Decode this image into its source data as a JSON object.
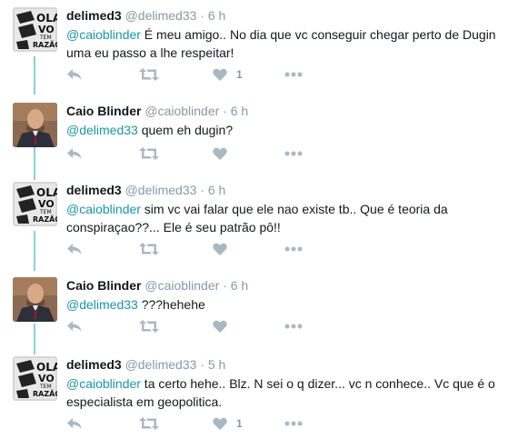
{
  "tweets": [
    {
      "author": "delimed3",
      "handle": "@delimed33",
      "time": "6 h",
      "mention": "@caioblinder",
      "text": " É meu amigo.. No dia que vc conseguir chegar perto de Dugin uma eu passo a lhe respeitar!",
      "like_count": "1",
      "avatar": "delimed-avatar"
    },
    {
      "author": "Caio Blinder",
      "handle": "@caioblinder",
      "time": "6 h",
      "mention": "@delimed33",
      "text": " quem eh dugin?",
      "like_count": "",
      "avatar": "caio-avatar"
    },
    {
      "author": "delimed3",
      "handle": "@delimed33",
      "time": "6 h",
      "mention": "@caioblinder",
      "text": " sim vc vai falar que ele nao existe tb.. Que é teoria da conspiraçao??... Ele é seu patrão pô!!",
      "like_count": "",
      "avatar": "delimed-avatar"
    },
    {
      "author": "Caio Blinder",
      "handle": "@caioblinder",
      "time": "6 h",
      "mention": "@delimed33",
      "text": " ???hehehe",
      "like_count": "",
      "avatar": "caio-avatar"
    },
    {
      "author": "delimed3",
      "handle": "@delimed33",
      "time": "5 h",
      "mention": "@caioblinder",
      "text": " ta certo hehe.. Blz. N sei o q dizer... vc n conhece.. Vc que é o especialista em geopolitica.",
      "like_count": "1",
      "avatar": "delimed-avatar"
    }
  ],
  "separator": "·",
  "avatar_logo": {
    "line1": "OLA",
    "line2": "VO",
    "line3": "TEM",
    "line4": "RAZÃO"
  },
  "colors": {
    "mention": "#1b95a3",
    "thread_line": "#8bcfd4",
    "icon": "#aab8c2",
    "meta": "#8899a6"
  }
}
